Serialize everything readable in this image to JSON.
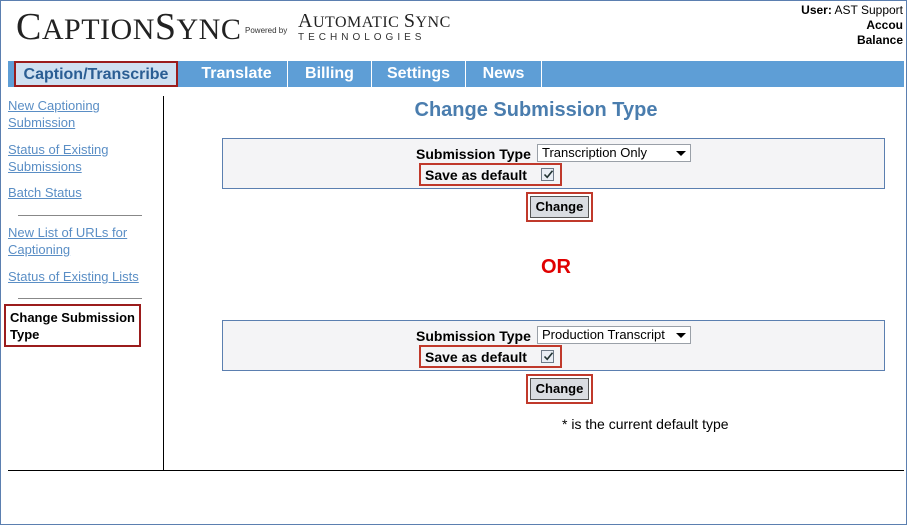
{
  "header": {
    "logo_main_first": "C",
    "logo_main_rest": "APTION",
    "logo_main_s": "S",
    "logo_main_ync": "YNC",
    "powered_by": "Powered by",
    "company_line1_a": "A",
    "company_line1_b": "UTOMATIC ",
    "company_line1_c": "S",
    "company_line1_d": "YNC",
    "company_line2": "TECHNOLOGIES",
    "user_label": "User:",
    "user_name": "AST Support",
    "account_label": "Accou",
    "balance_label": "Balance"
  },
  "nav": {
    "tabs": [
      {
        "label": "Caption/Transcribe",
        "active": true
      },
      {
        "label": "Translate"
      },
      {
        "label": "Billing"
      },
      {
        "label": "Settings"
      },
      {
        "label": "News"
      }
    ]
  },
  "sidebar": {
    "links": [
      {
        "label": "New Captioning Submission"
      },
      {
        "label": "Status of Existing Submissions"
      },
      {
        "label": "Batch Status"
      },
      {
        "label": "New List of URLs for Captioning"
      },
      {
        "label": "Status of Existing Lists"
      }
    ],
    "current": "Change Submission Type"
  },
  "main": {
    "title": "Change Submission Type",
    "forms": [
      {
        "type_label": "Submission Type",
        "type_value": "Transcription Only",
        "default_label": "Save as default",
        "default_checked": true,
        "button_label": "Change"
      },
      {
        "type_label": "Submission Type",
        "type_value": "Production Transcript",
        "default_label": "Save as default",
        "default_checked": true,
        "button_label": "Change"
      }
    ],
    "or_text": "OR",
    "note": "* is the current default type"
  },
  "colors": {
    "nav_bg": "#5e9ed6",
    "link": "#5a8ec5",
    "title": "#4a7dae",
    "or_red": "#e00000",
    "highlight": "#c0392b"
  }
}
